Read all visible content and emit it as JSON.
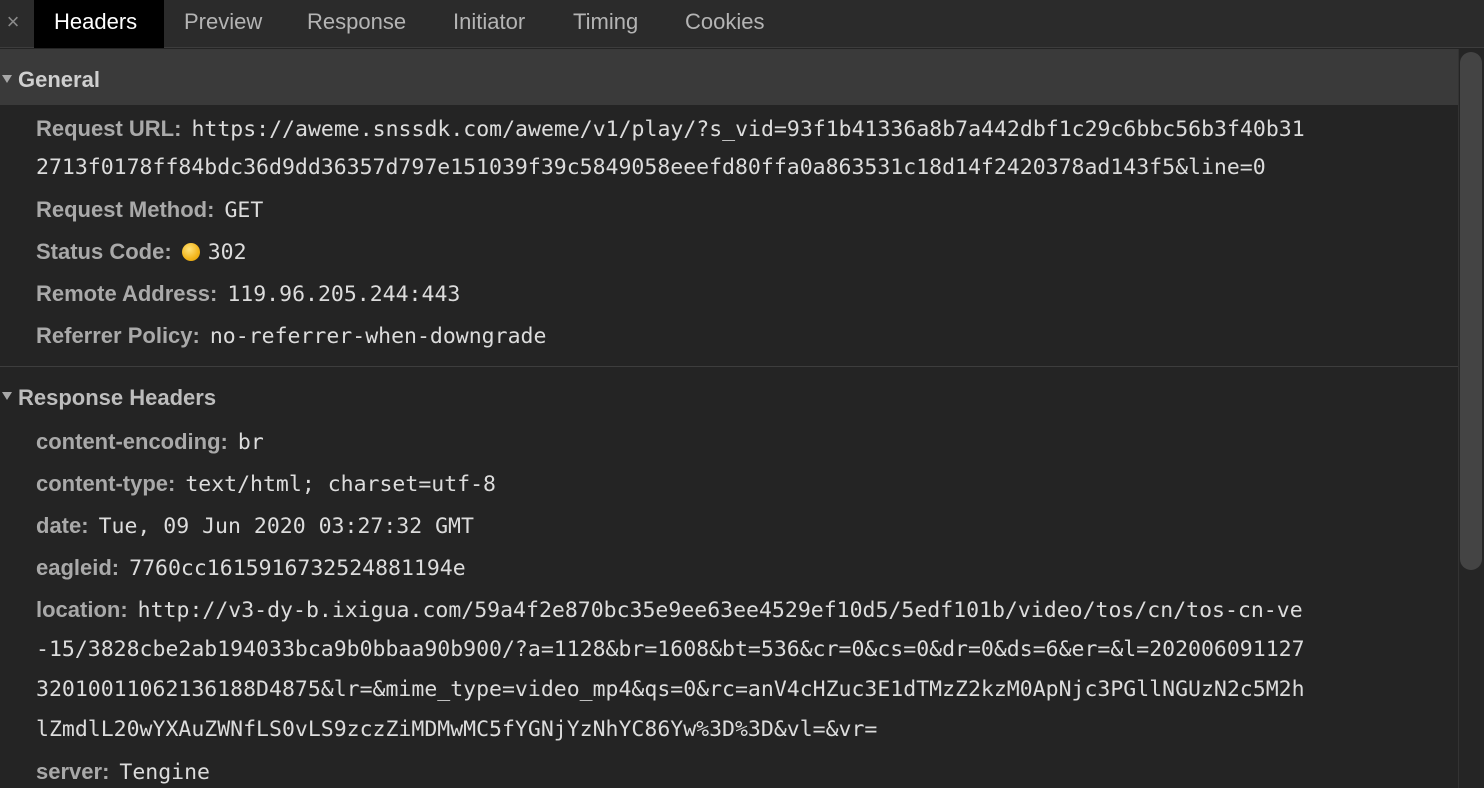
{
  "tabs": {
    "close": "×",
    "items": [
      "Headers",
      "Preview",
      "Response",
      "Initiator",
      "Timing",
      "Cookies"
    ]
  },
  "general": {
    "title": "General",
    "request_url_key": "Request URL:",
    "request_url_line1": "https://aweme.snssdk.com/aweme/v1/play/?s_vid=93f1b41336a8b7a442dbf1c29c6bbc56b3f40b31",
    "request_url_line2": "2713f0178ff84bdc36d9dd36357d797e151039f39c5849058eeefd80ffa0a863531c18d14f2420378ad143f5&line=0",
    "request_method_key": "Request Method:",
    "request_method": "GET",
    "status_code_key": "Status Code:",
    "status_code": "302",
    "status_color": "#f2b51b",
    "remote_address_key": "Remote Address:",
    "remote_address": "119.96.205.244:443",
    "referrer_policy_key": "Referrer Policy:",
    "referrer_policy": "no-referrer-when-downgrade"
  },
  "response_headers": {
    "title": "Response Headers",
    "content_encoding_key": "content-encoding:",
    "content_encoding": "br",
    "content_type_key": "content-type:",
    "content_type": "text/html; charset=utf-8",
    "date_key": "date:",
    "date": "Tue, 09 Jun 2020 03:27:32 GMT",
    "eagleid_key": "eagleid:",
    "eagleid": "7760cc1615916732524881194e",
    "location_key": "location:",
    "location_line1": "http://v3-dy-b.ixigua.com/59a4f2e870bc35e9ee63ee4529ef10d5/5edf101b/video/tos/cn/tos-cn-ve",
    "location_line2": "-15/3828cbe2ab194033bca9b0bbaa90b900/?a=1128&br=1608&bt=536&cr=0&cs=0&dr=0&ds=6&er=&l=202006091127",
    "location_line3": "3201001106213618 8D4875&lr=&mime_type=video_mp4&qs=0&rc=anV4cHZuc3E1dTMzZ2kzM0ApNjc3PGllNGUzN2c5M2h",
    "location_line4": "lZmdlL20wYXAuZWNfLS0vLS9zczZiMDMwMC5fYGNjYzNhYC86Yw%3D%3D&vl=&vr=",
    "server_key": "server:",
    "server": "Tengine"
  }
}
